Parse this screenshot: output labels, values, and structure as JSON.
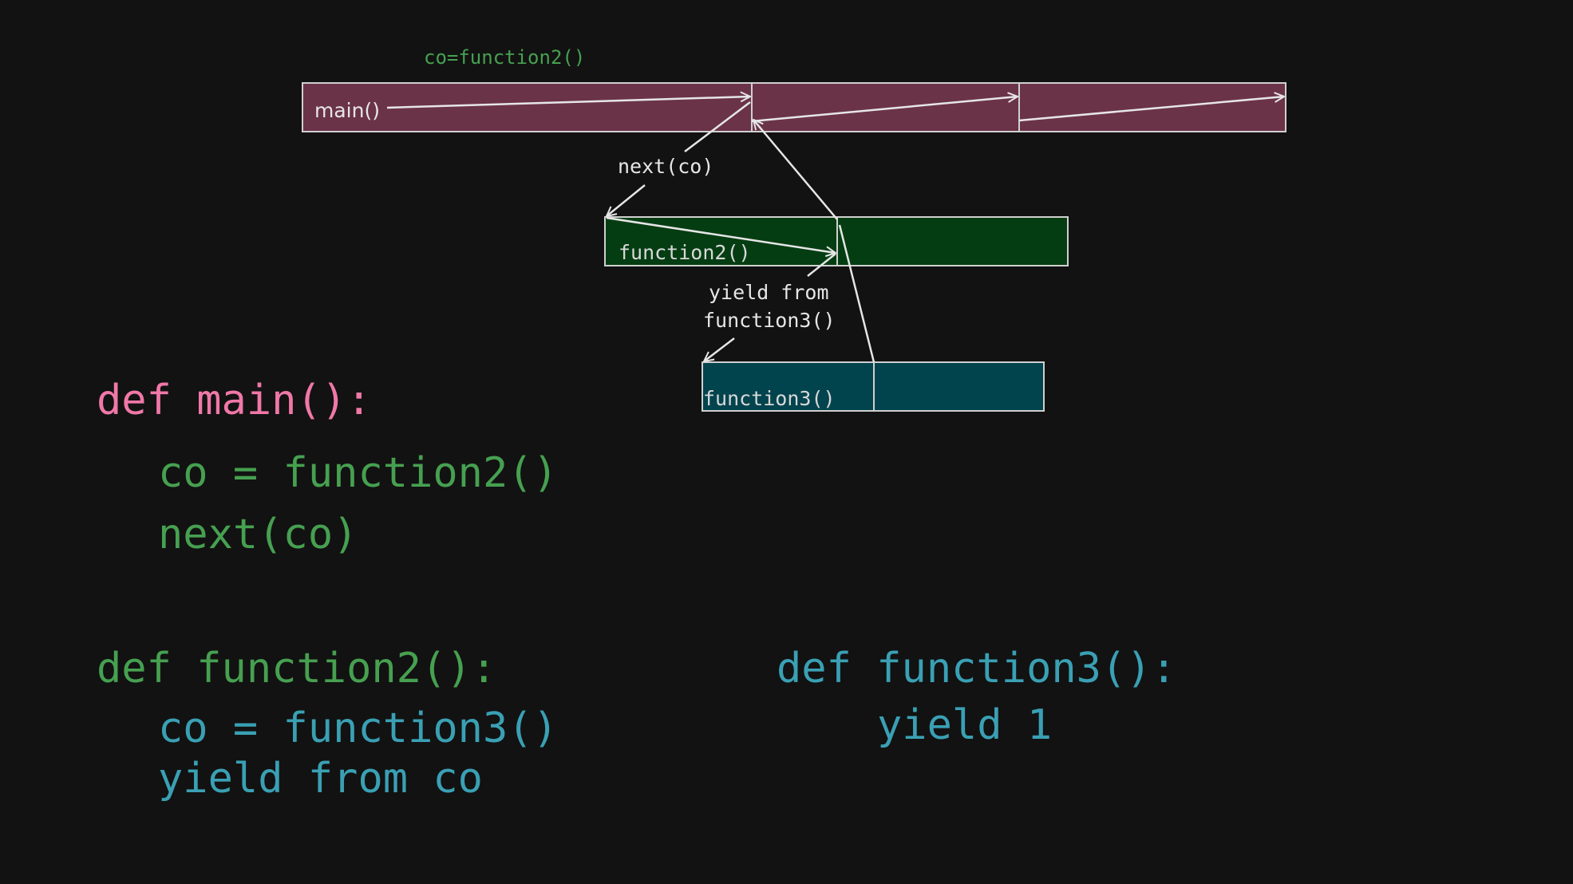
{
  "colors": {
    "background": "#121212",
    "main_bar": "#6b3348",
    "function2_bar": "#053d12",
    "function3_bar": "#02444e",
    "bar_border": "#d0d0d0",
    "arrow": "#e6e6e6",
    "def_main": "#f078a8",
    "def_function2": "#46a050",
    "def_function3": "#3aa0b4"
  },
  "diagram": {
    "top_annotation": "co=function2()",
    "main_bar_label": "main()",
    "next_label": "next(co)",
    "function2_bar_label": "function2()",
    "yield_label_line1": "yield from",
    "yield_label_line2": "function3()",
    "function3_bar_label": "function3()"
  },
  "code": {
    "main": {
      "def_line": "def main():",
      "lines": [
        "co = function2()",
        "next(co)"
      ]
    },
    "function2": {
      "def_line": "def function2():",
      "lines": [
        "co = function3()",
        "yield from co"
      ]
    },
    "function3": {
      "def_line": "def function3():",
      "lines": [
        "yield 1"
      ]
    }
  }
}
